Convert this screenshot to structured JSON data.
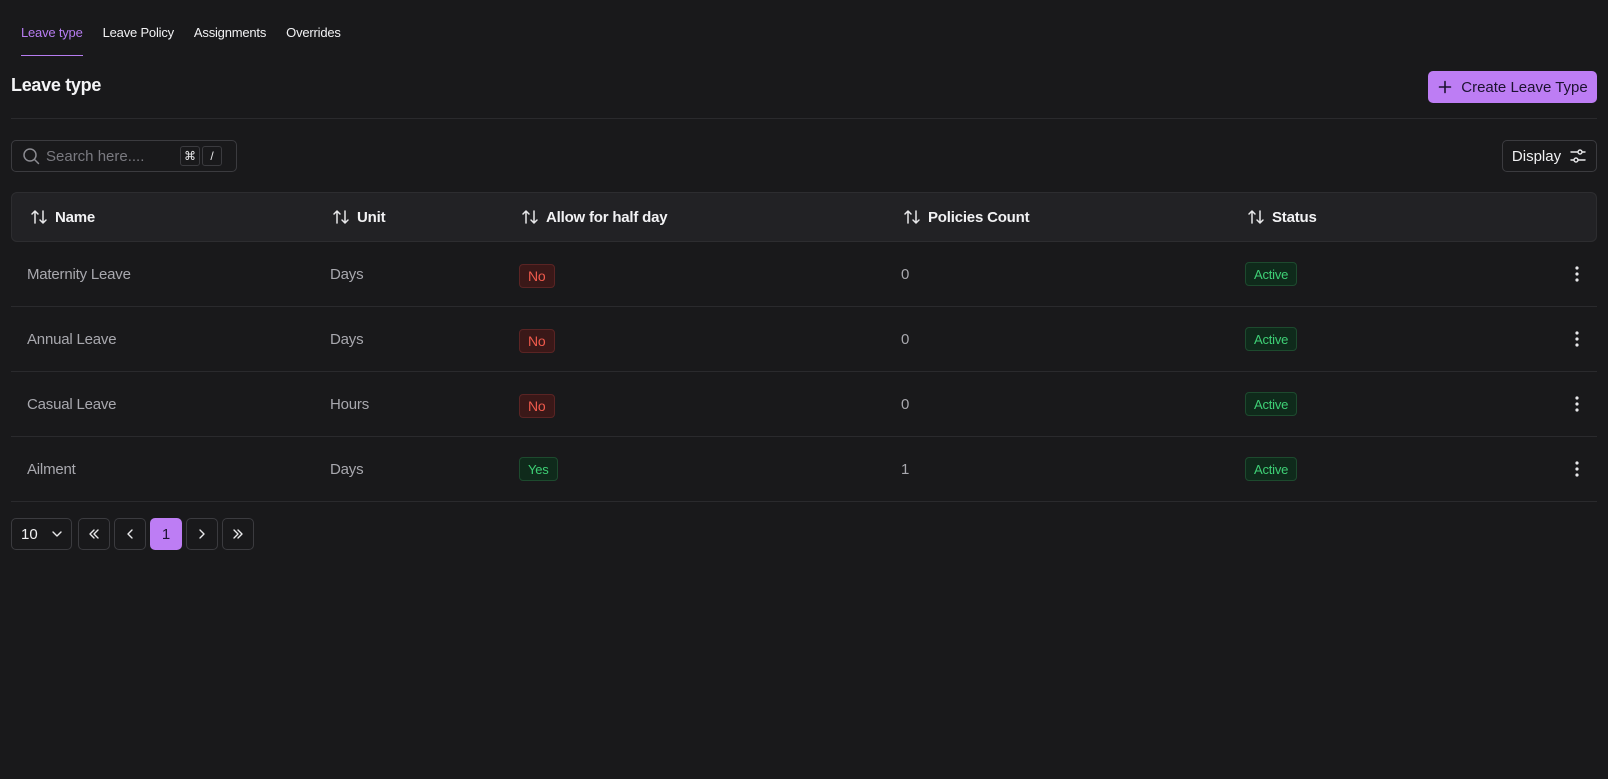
{
  "tabs": [
    {
      "label": "Leave type",
      "active": true
    },
    {
      "label": "Leave Policy",
      "active": false
    },
    {
      "label": "Assignments",
      "active": false
    },
    {
      "label": "Overrides",
      "active": false
    }
  ],
  "header": {
    "title": "Leave type",
    "create_label": "Create Leave Type"
  },
  "toolbar": {
    "search_placeholder": "Search here....",
    "shortcut_key_1": "⌘",
    "shortcut_key_2": "/",
    "display_label": "Display"
  },
  "table": {
    "columns": [
      "Name",
      "Unit",
      "Allow for half day",
      "Policies Count",
      "Status"
    ],
    "rows": [
      {
        "name": "Maternity Leave",
        "unit": "Days",
        "half_day": "No",
        "policies_count": "0",
        "status": "Active"
      },
      {
        "name": "Annual Leave",
        "unit": "Days",
        "half_day": "No",
        "policies_count": "0",
        "status": "Active"
      },
      {
        "name": "Casual Leave",
        "unit": "Hours",
        "half_day": "No",
        "policies_count": "0",
        "status": "Active"
      },
      {
        "name": "Ailment",
        "unit": "Days",
        "half_day": "Yes",
        "policies_count": "1",
        "status": "Active"
      }
    ]
  },
  "pagination": {
    "page_size": "10",
    "current_page": "1"
  },
  "colors": {
    "accent": "#bd7df4",
    "background": "#19191b",
    "positive": "#3ecf75",
    "negative": "#f05a4c"
  }
}
